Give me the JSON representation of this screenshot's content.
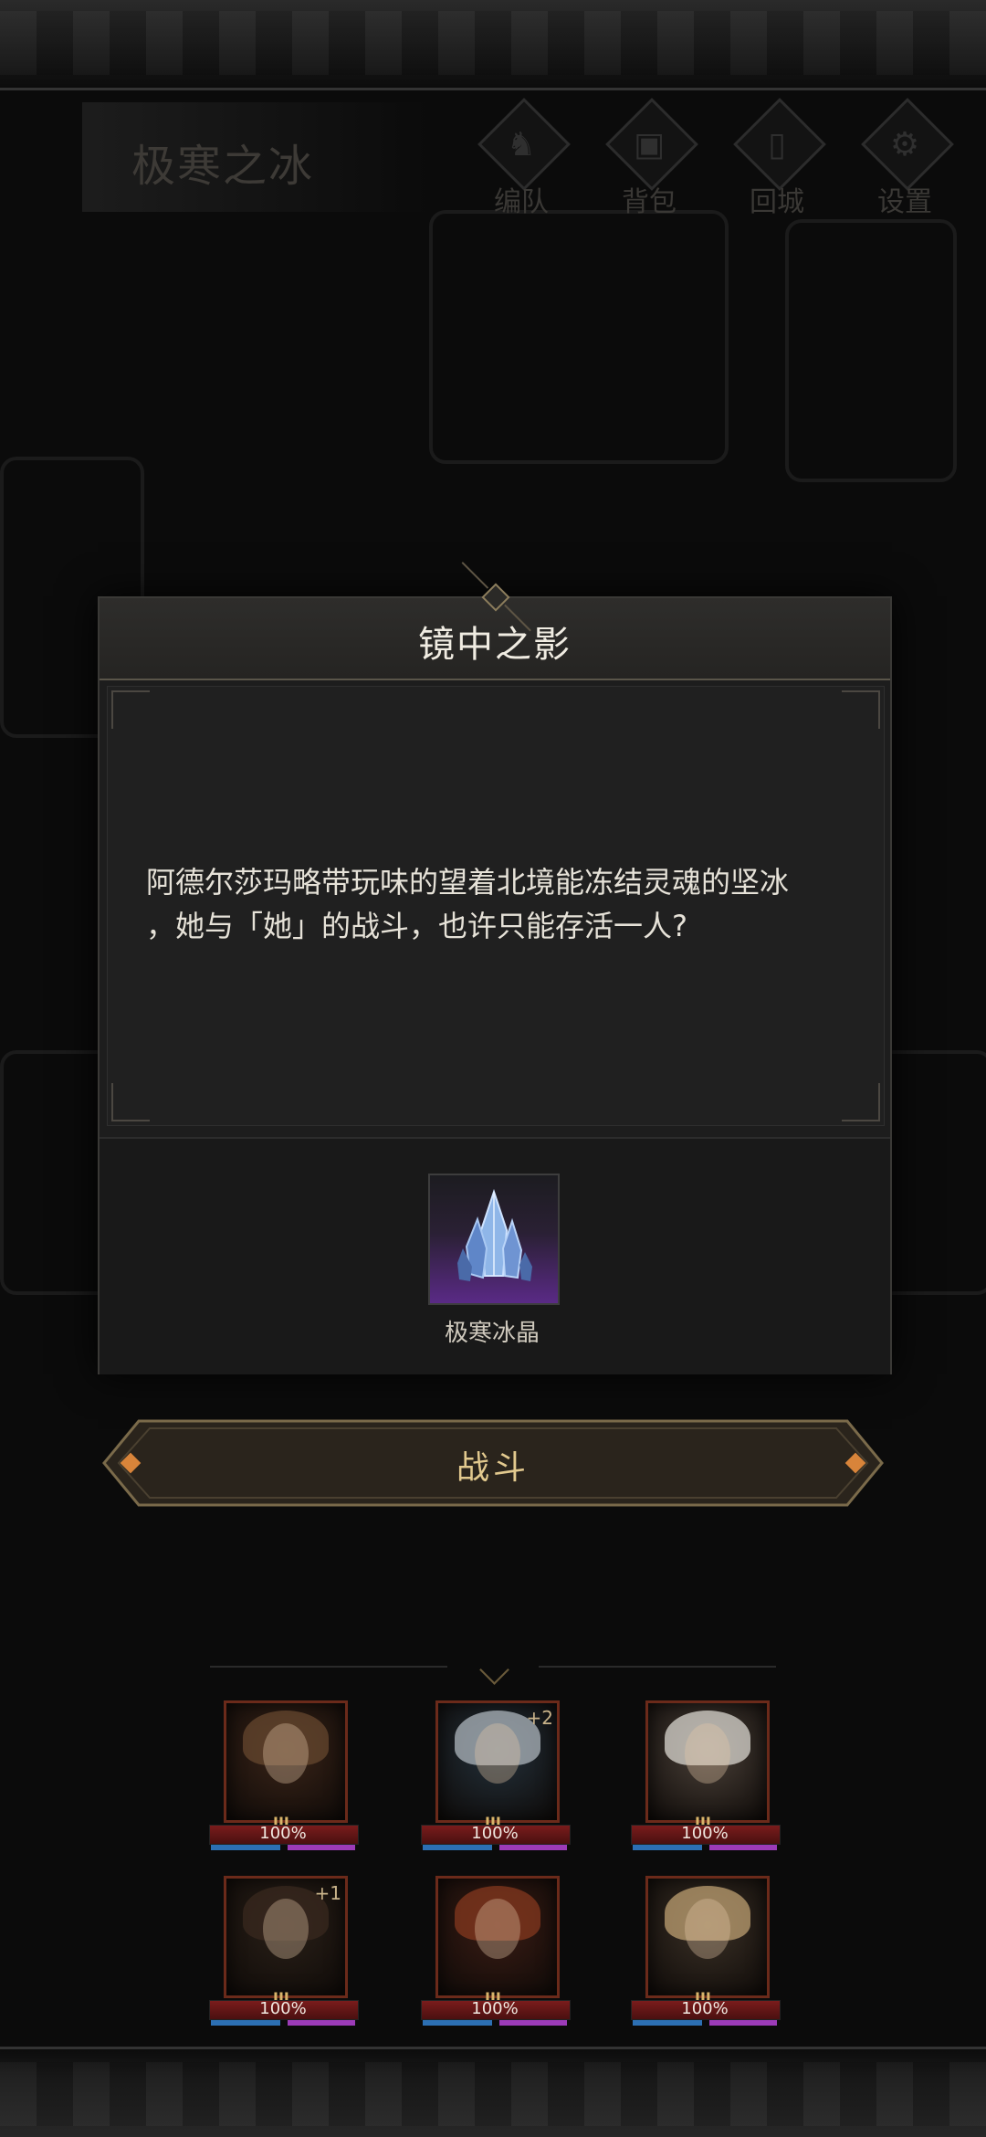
{
  "stage": {
    "title": "极寒之冰"
  },
  "toolbar": {
    "buttons": [
      {
        "label": "编队",
        "icon": "formation-icon"
      },
      {
        "label": "背包",
        "icon": "backpack-icon"
      },
      {
        "label": "回城",
        "icon": "return-town-icon"
      },
      {
        "label": "设置",
        "icon": "gear-icon"
      }
    ]
  },
  "dialog": {
    "title": "镜中之影",
    "description_lines": [
      "阿德尔莎玛略带玩味的望着北境能冻结灵魂的坚冰",
      "，她与「她」的战斗，也许只能存活一人?"
    ],
    "reward": {
      "name": "极寒冰晶",
      "icon": "ice-crystal-icon"
    }
  },
  "fight_button": {
    "label": "战斗"
  },
  "team": {
    "heroes": [
      {
        "hp": "100%",
        "rank": "III",
        "bonus": "",
        "hair_color": "#6a4a30",
        "frame_bg": "#3a2418"
      },
      {
        "hp": "100%",
        "rank": "III",
        "bonus": "+2",
        "hair_color": "#b8c0c8",
        "frame_bg": "#23303a"
      },
      {
        "hp": "100%",
        "rank": "III",
        "bonus": "",
        "hair_color": "#e6e2dc",
        "frame_bg": "#4a4038"
      },
      {
        "hp": "100%",
        "rank": "III",
        "bonus": "+1",
        "hair_color": "#3a2a20",
        "frame_bg": "#2a2018"
      },
      {
        "hp": "100%",
        "rank": "III",
        "bonus": "",
        "hair_color": "#8a3a20",
        "frame_bg": "#3a1c14"
      },
      {
        "hp": "100%",
        "rank": "III",
        "bonus": "",
        "hair_color": "#c8a878",
        "frame_bg": "#3a3026"
      }
    ]
  },
  "colors": {
    "accent_gold": "#e2c98e",
    "hp_blue": "#2c6fb3",
    "mp_purple": "#9c3bb8",
    "hp_bar_red": "#7a1c1c"
  }
}
